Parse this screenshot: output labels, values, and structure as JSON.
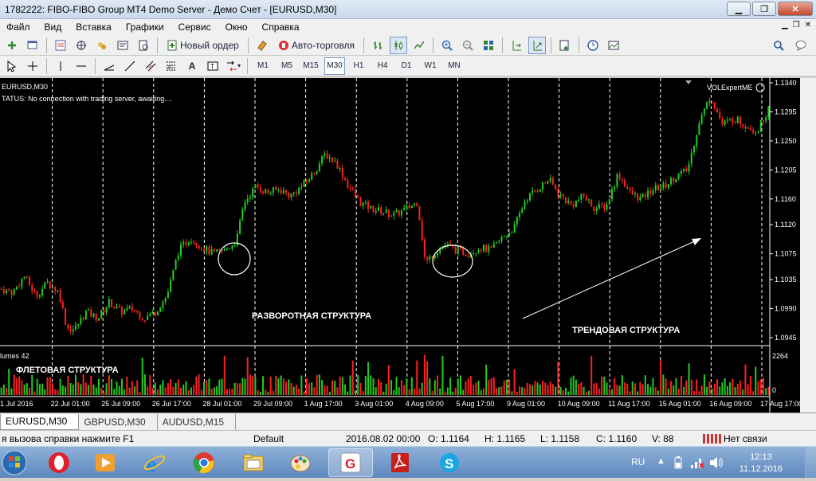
{
  "window": {
    "title": "1782222: FIBO-FIBO Group MT4 Demo Server - Демо Счет - [EURUSD,M30]"
  },
  "menu": {
    "items": [
      "Файл",
      "Вид",
      "Вставка",
      "Графики",
      "Сервис",
      "Окно",
      "Справка"
    ]
  },
  "toolbar": {
    "new_order_label": "Новый ордер",
    "auto_trading_label": "Авто-торговля",
    "text_tool_label": "A",
    "timeframes": [
      "M1",
      "M5",
      "M15",
      "M30",
      "H1",
      "H4",
      "D1",
      "W1",
      "MN"
    ],
    "selected_timeframe": "M30"
  },
  "chart": {
    "symbol_label": "EURUSD,M30",
    "status_label": "TATUS:  No connection with trading server, awaiting....",
    "expert_label": "VOLExpertME",
    "volumes_label": "lumes 42",
    "annotations": {
      "reversal": "РАЗВОРОТНАЯ СТРУКТУРА",
      "trend": "ТРЕНДОВАЯ СТРУКТУРА",
      "flat": "ФЛЕТОВАЯ СТРУКТУРА"
    },
    "colors": {
      "bull": "#22cc22",
      "bear": "#ff2020",
      "grid": "#ffffff",
      "background": "#000000"
    }
  },
  "chart_data": {
    "type": "candlestick",
    "symbol": "EURUSD",
    "timeframe": "M30",
    "y_ticks": [
      "1.1340",
      "1.1295",
      "1.1250",
      "1.1205",
      "1.1160",
      "1.1120",
      "1.1075",
      "1.1035",
      "1.0990",
      "1.0945"
    ],
    "ylim": [
      1.0935,
      1.1345
    ],
    "x_ticks": [
      "1 Jul 2016",
      "22 Jul 01:00",
      "25 Jul 09:00",
      "26 Jul 17:00",
      "28 Jul 01:00",
      "29 Jul 09:00",
      "1 Aug 17:00",
      "3 Aug 01:00",
      "4 Aug 09:00",
      "5 Aug 17:00",
      "9 Aug 01:00",
      "10 Aug 09:00",
      "11 Aug 17:00",
      "15 Aug 01:00",
      "16 Aug 09:00",
      "17 Aug 17:00"
    ],
    "price_path": [
      [
        0,
        1.102
      ],
      [
        3,
        1.1015
      ],
      [
        6,
        1.104
      ],
      [
        9,
        1.101
      ],
      [
        12,
        1.103
      ],
      [
        15,
        1.1015
      ],
      [
        17,
        1.096
      ],
      [
        19,
        1.0958
      ],
      [
        22,
        1.0985
      ],
      [
        25,
        1.0975
      ],
      [
        28,
        1.1
      ],
      [
        31,
        1.0985
      ],
      [
        34,
        1.099
      ],
      [
        37,
        1.0975
      ],
      [
        40,
        1.0985
      ],
      [
        43,
        1.101
      ],
      [
        46,
        1.108
      ],
      [
        49,
        1.11
      ],
      [
        52,
        1.1085
      ],
      [
        55,
        1.1075
      ],
      [
        58,
        1.108
      ],
      [
        61,
        1.1095
      ],
      [
        63,
        1.1155
      ],
      [
        66,
        1.118
      ],
      [
        69,
        1.117
      ],
      [
        72,
        1.1175
      ],
      [
        75,
        1.1165
      ],
      [
        78,
        1.118
      ],
      [
        81,
        1.12
      ],
      [
        84,
        1.123
      ],
      [
        87,
        1.1215
      ],
      [
        90,
        1.118
      ],
      [
        93,
        1.1155
      ],
      [
        96,
        1.1145
      ],
      [
        99,
        1.114
      ],
      [
        102,
        1.1135
      ],
      [
        105,
        1.1145
      ],
      [
        108,
        1.1155
      ],
      [
        110,
        1.106
      ],
      [
        112,
        1.1075
      ],
      [
        115,
        1.109
      ],
      [
        118,
        1.108
      ],
      [
        121,
        1.1075
      ],
      [
        124,
        1.1085
      ],
      [
        127,
        1.108
      ],
      [
        130,
        1.11
      ],
      [
        133,
        1.1115
      ],
      [
        136,
        1.116
      ],
      [
        139,
        1.1175
      ],
      [
        142,
        1.119
      ],
      [
        145,
        1.1165
      ],
      [
        148,
        1.115
      ],
      [
        151,
        1.1165
      ],
      [
        154,
        1.1145
      ],
      [
        157,
        1.115
      ],
      [
        160,
        1.12
      ],
      [
        163,
        1.117
      ],
      [
        166,
        1.116
      ],
      [
        169,
        1.1175
      ],
      [
        172,
        1.118
      ],
      [
        175,
        1.1195
      ],
      [
        178,
        1.1205
      ],
      [
        181,
        1.128
      ],
      [
        184,
        1.132
      ],
      [
        187,
        1.1275
      ],
      [
        190,
        1.1285
      ],
      [
        193,
        1.1275
      ],
      [
        196,
        1.1265
      ],
      [
        199,
        1.13
      ]
    ],
    "volumes_max_label": "2264",
    "volumes_zero_label": "0"
  },
  "tabs": [
    "EURUSD,M30",
    "GBPUSD,M30",
    "AUDUSD,M15"
  ],
  "active_tab": "EURUSD,M30",
  "status": {
    "help": "я вызова справки нажмите F1",
    "profile": "Default",
    "datetime": "2016.08.02 00:00",
    "open": "O: 1.1164",
    "high": "H: 1.1165",
    "low": "L: 1.1158",
    "close": "C: 1.1160",
    "volume": "V: 88",
    "connection": "Нет связи"
  },
  "taskbar": {
    "lang": "RU",
    "time": "12:13",
    "date": "11.12.2016",
    "apps": [
      "opera-icon",
      "media-player-icon",
      "internet-explorer-icon",
      "chrome-icon",
      "file-explorer-icon",
      "paint-icon",
      "fibo-icon",
      "pdf-reader-icon",
      "skype-icon"
    ]
  }
}
